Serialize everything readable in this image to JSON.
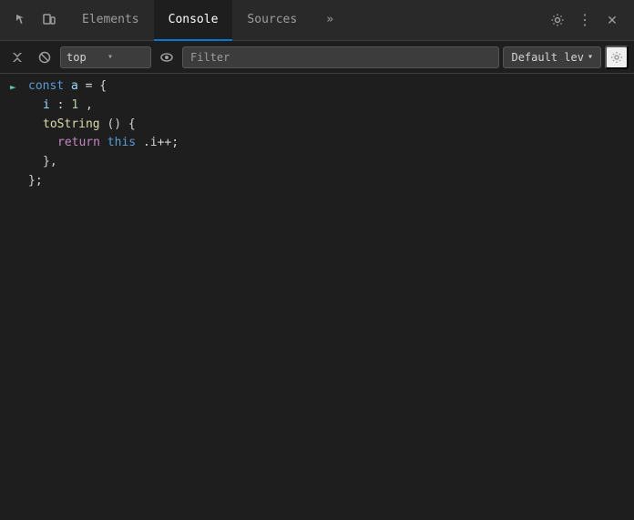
{
  "tabs": {
    "items": [
      {
        "id": "elements",
        "label": "Elements",
        "active": false
      },
      {
        "id": "console",
        "label": "Console",
        "active": true
      },
      {
        "id": "sources",
        "label": "Sources",
        "active": false
      },
      {
        "id": "more",
        "label": "»",
        "active": false
      }
    ]
  },
  "toolbar": {
    "context_value": "top",
    "filter_placeholder": "Filter",
    "default_level_label": "Default lev"
  },
  "console": {
    "lines": [
      {
        "type": "input",
        "content": "const a = {"
      },
      {
        "type": "continuation",
        "content": "  i: 1,"
      },
      {
        "type": "continuation",
        "content": "  toString() {"
      },
      {
        "type": "continuation",
        "content": "    return this.i++;"
      },
      {
        "type": "continuation",
        "content": "  },"
      },
      {
        "type": "continuation",
        "content": "};"
      }
    ]
  },
  "icons": {
    "inspect": "⬚",
    "device": "⬡",
    "chevron_down": "▾",
    "eye": "◉",
    "filter": "Filter",
    "gear": "⚙",
    "more_vert": "⋮",
    "close": "✕",
    "play": "▶",
    "ban": "⊘",
    "prompt": ">"
  }
}
